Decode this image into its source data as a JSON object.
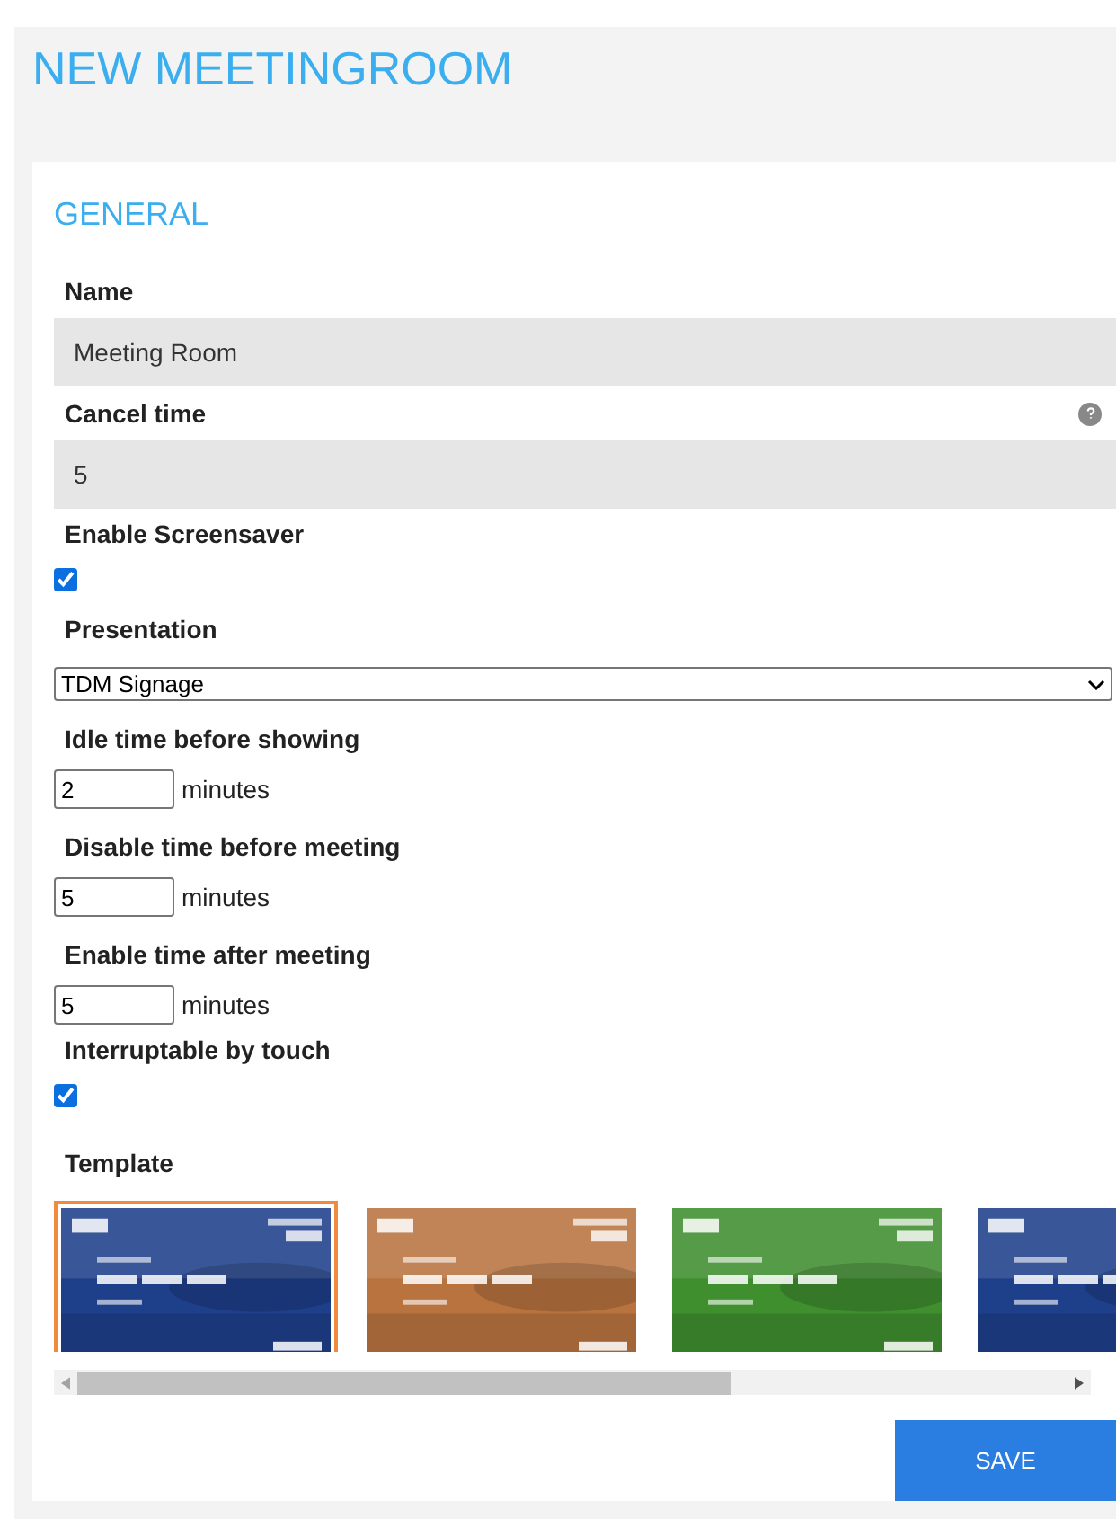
{
  "header": {
    "title": "NEW MEETINGROOM"
  },
  "section": {
    "title": "GENERAL"
  },
  "fields": [
    {
      "kind": "text",
      "label": "Name",
      "value": "Meeting Room"
    },
    {
      "kind": "text",
      "label": "Cancel time",
      "value": "5",
      "help": true
    },
    {
      "kind": "checkbox",
      "label": "Enable Screensaver",
      "checked": true
    },
    {
      "kind": "select",
      "label": "Presentation",
      "value": "TDM Signage"
    },
    {
      "kind": "number",
      "label": "Idle time before showing",
      "value": "2",
      "unit": "minutes"
    },
    {
      "kind": "number",
      "label": "Disable time before meeting",
      "value": "5",
      "unit": "minutes"
    },
    {
      "kind": "number",
      "label": "Enable time after meeting",
      "value": "5",
      "unit": "minutes"
    },
    {
      "kind": "checkbox",
      "label": "Interruptable by touch",
      "checked": true
    }
  ],
  "template": {
    "label": "Template",
    "items": [
      {
        "color": "#1e3f8a",
        "selected": true
      },
      {
        "color": "#b8733f",
        "selected": false
      },
      {
        "color": "#3f8f2f",
        "selected": false
      },
      {
        "color": "#1e3f8a",
        "selected": false
      }
    ]
  },
  "save_button": "SAVE"
}
